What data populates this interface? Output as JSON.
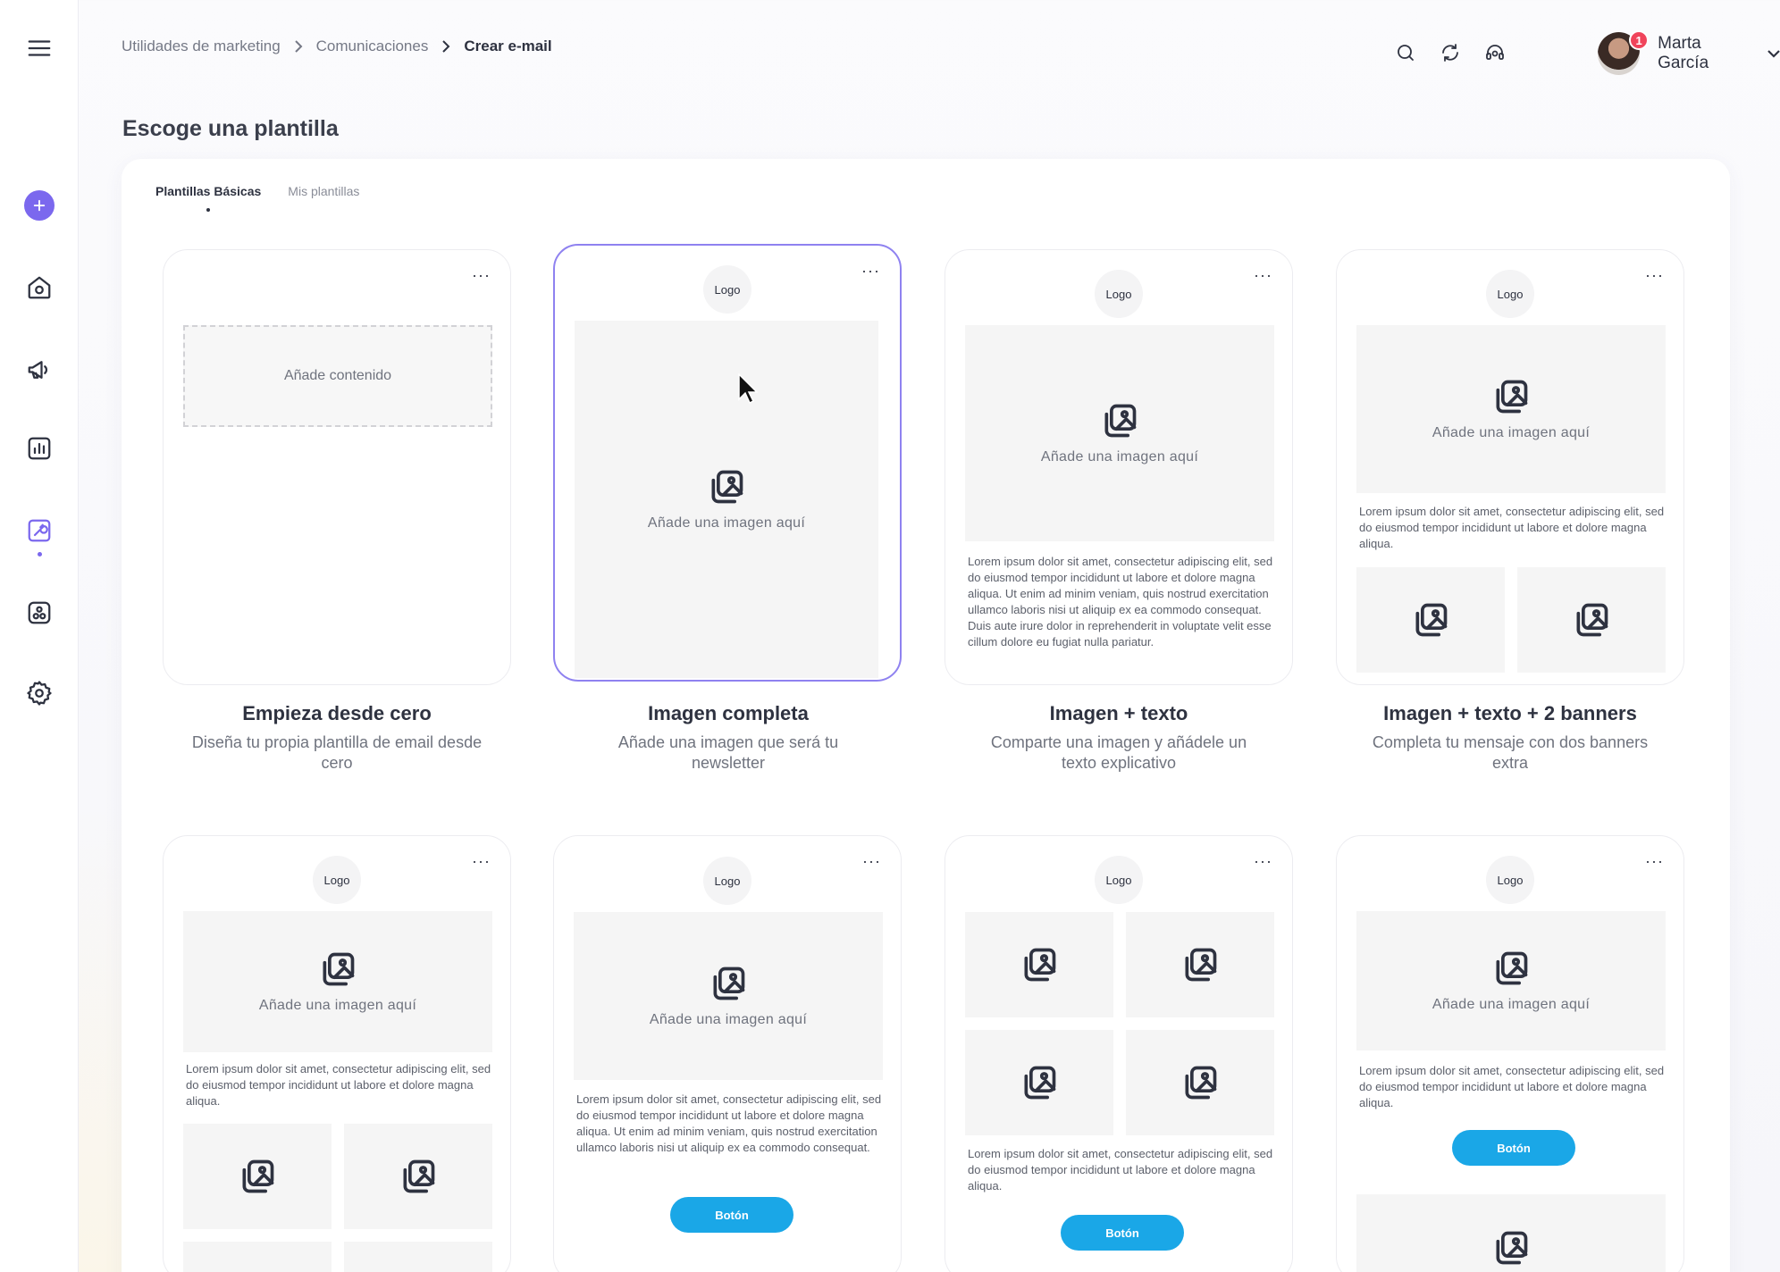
{
  "breadcrumb": {
    "items": [
      "Utilidades de marketing",
      "Comunicaciones"
    ],
    "current": "Crear e-mail"
  },
  "user": {
    "name": "Marta García",
    "notifications": "1"
  },
  "page": {
    "title": "Escoge una plantilla"
  },
  "tabs": [
    {
      "label": "Plantillas Básicas",
      "active": true
    },
    {
      "label": "Mis plantillas",
      "active": false
    }
  ],
  "common": {
    "logo": "Logo",
    "image_placeholder": "Añade una imagen aquí",
    "add_content": "Añade contenido",
    "button": "Botón",
    "more": "···",
    "lorem_short": "Lorem ipsum dolor sit amet, consectetur adipiscing elit, sed do eiusmod tempor incididunt ut labore et dolore magna aliqua.",
    "lorem_medium": "Lorem ipsum dolor sit amet, consectetur adipiscing elit, sed do eiusmod tempor incididunt ut labore et dolore magna aliqua. Ut enim ad minim veniam, quis nostrud exercitation ullamco laboris nisi ut aliquip ex ea commodo consequat.",
    "lorem_long": "Lorem ipsum dolor sit amet, consectetur adipiscing elit, sed do eiusmod tempor incididunt ut labore et dolore magna aliqua. Ut enim ad minim veniam, quis nostrud exercitation ullamco laboris nisi ut aliquip ex ea commodo consequat. Duis aute irure dolor in reprehenderit in voluptate velit esse cillum dolore eu fugiat nulla pariatur."
  },
  "templates": [
    {
      "title": "Empieza desde cero",
      "description": "Diseña tu propia plantilla de email desde cero"
    },
    {
      "title": "Imagen completa",
      "description": "Añade una imagen que será tu newsletter",
      "selected": true
    },
    {
      "title": "Imagen + texto",
      "description": "Comparte una imagen y añádele un texto explicativo"
    },
    {
      "title": "Imagen + texto + 2 banners",
      "description": "Completa tu mensaje con dos banners extra"
    }
  ],
  "icons": {
    "menu": "menu-icon",
    "add": "plus-icon",
    "home": "home-icon",
    "campaigns": "megaphone-icon",
    "reports": "chart-icon",
    "tools": "tools-icon",
    "apps": "apps-icon",
    "settings": "gear-icon",
    "search": "search-icon",
    "refresh": "refresh-icon",
    "support": "headset-icon",
    "image": "image-icon"
  },
  "colors": {
    "accent": "#7b68ee",
    "button": "#1aa7e7",
    "badge": "#f0445b",
    "selected_border": "#8f82f0"
  }
}
